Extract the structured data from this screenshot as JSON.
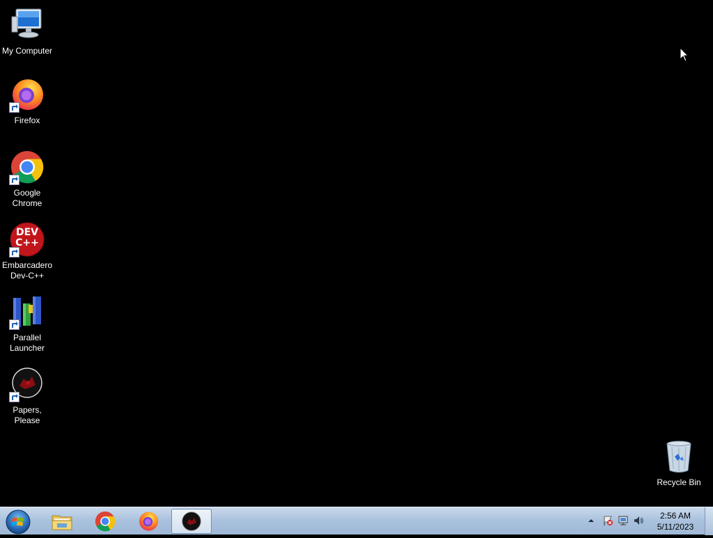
{
  "desktop": {
    "icons": [
      {
        "label": "My Computer",
        "icon": "computer-icon"
      },
      {
        "label": "Firefox",
        "icon": "firefox-icon"
      },
      {
        "label": "Google Chrome",
        "icon": "chrome-icon"
      },
      {
        "label": "Embarcadero Dev-C++",
        "icon": "devcpp-icon",
        "icon_text": "DEV C++"
      },
      {
        "label": "Parallel Launcher",
        "icon": "parallel-launcher-icon"
      },
      {
        "label": "Papers, Please",
        "icon": "papers-please-icon"
      }
    ],
    "recycle_bin": {
      "label": "Recycle Bin",
      "icon": "recycle-bin-icon"
    }
  },
  "taskbar": {
    "start": {
      "icon": "windows-start-icon"
    },
    "pinned": [
      {
        "name": "File Explorer",
        "icon": "folder-icon",
        "active": false
      },
      {
        "name": "Google Chrome",
        "icon": "chrome-icon",
        "active": false
      },
      {
        "name": "Firefox",
        "icon": "firefox-icon",
        "active": false
      },
      {
        "name": "Papers, Please",
        "icon": "papers-please-icon",
        "active": true
      }
    ],
    "tray": {
      "icons": [
        "show-hidden-icons-arrow",
        "action-center-flag-icon",
        "network-icon",
        "volume-icon"
      ],
      "time": "2:56 AM",
      "date": "5/11/2023"
    }
  },
  "colors": {
    "desktop_bg": "#000000",
    "taskbar_bg": "#a9c1dd",
    "label_text": "#ffffff"
  }
}
